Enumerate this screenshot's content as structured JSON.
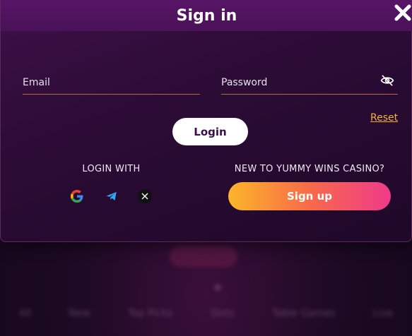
{
  "modal": {
    "title": "Sign in",
    "email_placeholder": "Email",
    "password_placeholder": "Password",
    "reset_label": "Reset",
    "login_label": "Login",
    "login_with_label": "LOGIN WITH",
    "social": [
      "google-icon",
      "telegram-icon",
      "x-icon"
    ],
    "new_to_label": "NEW TO YUMMY WINS CASINO?",
    "signup_label": "Sign up"
  },
  "background": {
    "nav": [
      "All",
      "New",
      "Top Picks",
      "Slots",
      "Table Games",
      "Live"
    ]
  },
  "colors": {
    "accent_orange": "#f4b33c",
    "signup_gradient_start": "#fbb52a",
    "signup_gradient_end": "#ef3a8a",
    "header_purple": "#571466"
  }
}
